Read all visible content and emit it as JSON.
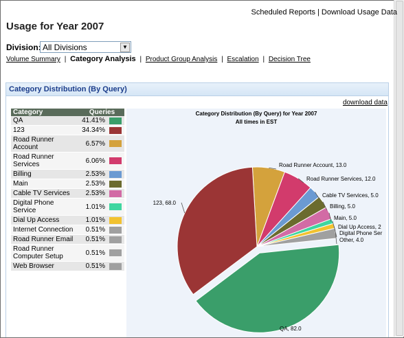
{
  "top_links": [
    "Scheduled Reports",
    "Download Usage Data"
  ],
  "page_title": "Usage for Year 2007",
  "division": {
    "label": "Division:",
    "selected": "All Divisions"
  },
  "nav": [
    {
      "label": "Volume Summary",
      "active": false
    },
    {
      "label": "Category Analysis",
      "active": true
    },
    {
      "label": "Product Group Analysis",
      "active": false
    },
    {
      "label": "Escalation",
      "active": false
    },
    {
      "label": "Decision Tree",
      "active": false
    }
  ],
  "panel_title": "Category Distribution (By Query)",
  "download_link": "download data",
  "table": {
    "headers": [
      "Category",
      "Queries"
    ],
    "rows": [
      {
        "category": "QA",
        "pct": "41.41%",
        "color": "#3a9e6a"
      },
      {
        "category": "123",
        "pct": "34.34%",
        "color": "#9b3535"
      },
      {
        "category": "Road Runner Account",
        "pct": "6.57%",
        "color": "#d4a23c"
      },
      {
        "category": "Road Runner Services",
        "pct": "6.06%",
        "color": "#d23b6c"
      },
      {
        "category": "Billing",
        "pct": "2.53%",
        "color": "#6b9ad2"
      },
      {
        "category": "Main",
        "pct": "2.53%",
        "color": "#6b6b2e"
      },
      {
        "category": "Cable TV Services",
        "pct": "2.53%",
        "color": "#d26ba5"
      },
      {
        "category": "Digital Phone Service",
        "pct": "1.01%",
        "color": "#3fd6a0"
      },
      {
        "category": "Dial Up Access",
        "pct": "1.01%",
        "color": "#f2c230"
      },
      {
        "category": "Internet Connection",
        "pct": "0.51%",
        "color": "#a0a0a0"
      },
      {
        "category": "Road Runner Email",
        "pct": "0.51%",
        "color": "#a0a0a0"
      },
      {
        "category": "Road Runner Computer Setup",
        "pct": "0.51%",
        "color": "#a0a0a0"
      },
      {
        "category": "Web Browser",
        "pct": "0.51%",
        "color": "#a0a0a0"
      }
    ]
  },
  "chart_data": {
    "type": "pie",
    "title": "Category Distribution (By Query) for Year 2007",
    "subtitle": "All times in EST",
    "slices": [
      {
        "label": "QA",
        "value": 82.0,
        "display": "QA, 82.0",
        "color": "#3a9e6a",
        "exploded": true
      },
      {
        "label": "123",
        "value": 68.0,
        "display": "123, 68.0",
        "color": "#9b3535"
      },
      {
        "label": "Road Runner Account",
        "value": 13.0,
        "display": "Road Runner Account, 13.0",
        "color": "#d4a23c"
      },
      {
        "label": "Road Runner Services",
        "value": 12.0,
        "display": "Road Runner Services, 12.0",
        "color": "#d23b6c"
      },
      {
        "label": "Cable TV Services",
        "value": 5.0,
        "display": "Cable TV Services, 5.0",
        "color": "#6b9ad2"
      },
      {
        "label": "Billing",
        "value": 5.0,
        "display": "Billing, 5.0",
        "color": "#6b6b2e"
      },
      {
        "label": "Main",
        "value": 5.0,
        "display": "Main, 5.0",
        "color": "#d26ba5"
      },
      {
        "label": "Dial Up Access",
        "value": 2.0,
        "display": "Dial Up Access, 2",
        "color": "#3fd6a0"
      },
      {
        "label": "Digital Phone Service",
        "value": 2.0,
        "display": "Digital Phone Ser",
        "color": "#f2c230"
      },
      {
        "label": "Other",
        "value": 4.0,
        "display": "Other, 4.0",
        "color": "#a0a0a0"
      }
    ]
  }
}
